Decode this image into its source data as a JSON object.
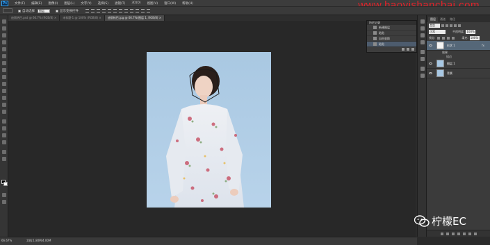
{
  "app": {
    "logo": "Ps",
    "menus": [
      "文件(F)",
      "编辑(E)",
      "图像(I)",
      "图层(L)",
      "文字(Y)",
      "选择(S)",
      "滤镜(T)",
      "3D(D)",
      "视图(V)",
      "窗口(W)",
      "帮助(H)"
    ],
    "watermark_url": "www.haoyishanchai.com"
  },
  "options": {
    "auto_select_label": "自动选择",
    "auto_select_value": "图层",
    "show_transform_label": "显示变换控件"
  },
  "tabs": [
    {
      "label": "迪丽热巴.psd @ 66.7% (RGB/8) ×"
    },
    {
      "label": "未标题-1 @ 100% (RGB/8) ×"
    },
    {
      "label": "迪丽热巴.jpg @ 66.7%(图层 1, RGB/8) ×"
    }
  ],
  "history": {
    "title": "历史记录",
    "items": [
      "新建图层",
      "粘贴",
      "自由变换",
      "粘贴"
    ]
  },
  "layers": {
    "tabs": [
      "图层",
      "通道",
      "路径"
    ],
    "filter_kind": "类型",
    "blend_mode": "正常",
    "opacity_label": "不透明度:",
    "opacity_value": "100%",
    "lock_label": "锁定:",
    "fill_label": "填充:",
    "fill_value": "100%",
    "rows": [
      {
        "name": "形状 1",
        "fx": "fx"
      },
      {
        "name": "图层 1"
      },
      {
        "name": "背景"
      }
    ],
    "effects_label": "效果",
    "effect_item": "描边"
  },
  "status": {
    "zoom": "66.67%",
    "doc_info": "文档:1.80M/4.00M"
  },
  "brand": {
    "text": "柠檬EC"
  },
  "colors": {
    "watermark": "#e0232a",
    "canvas_bg": "#282828",
    "photo_bg": "#b3cfe6"
  }
}
